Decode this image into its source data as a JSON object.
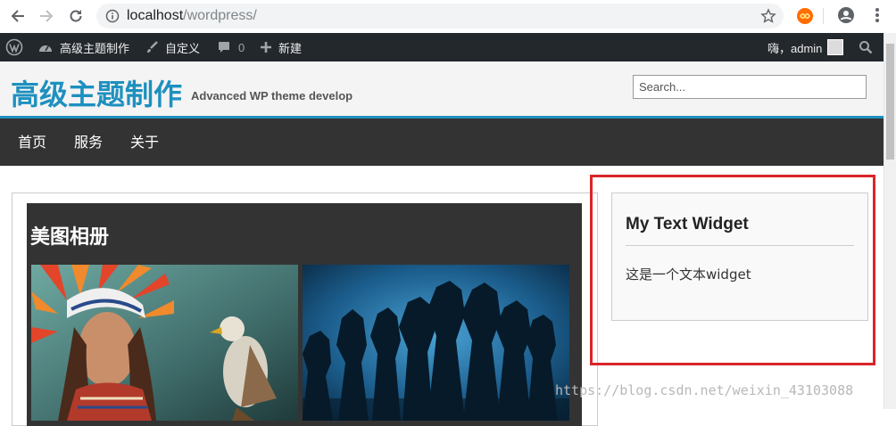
{
  "browser": {
    "url_host": "localhost",
    "url_path": "/wordpress/"
  },
  "adminbar": {
    "site_name": "高级主题制作",
    "customize": "自定义",
    "comments_count": "0",
    "new_label": "新建",
    "greeting": "嗨，admin"
  },
  "site": {
    "title": "高级主题制作",
    "description": "Advanced WP theme develop",
    "search_placeholder": "Search..."
  },
  "nav": {
    "items": [
      "首页",
      "服务",
      "关于"
    ]
  },
  "content": {
    "gallery_title": "美图相册"
  },
  "widget": {
    "title": "My Text Widget",
    "text": "这是一个文本widget"
  },
  "watermark": "https://blog.csdn.net/weixin_43103088"
}
